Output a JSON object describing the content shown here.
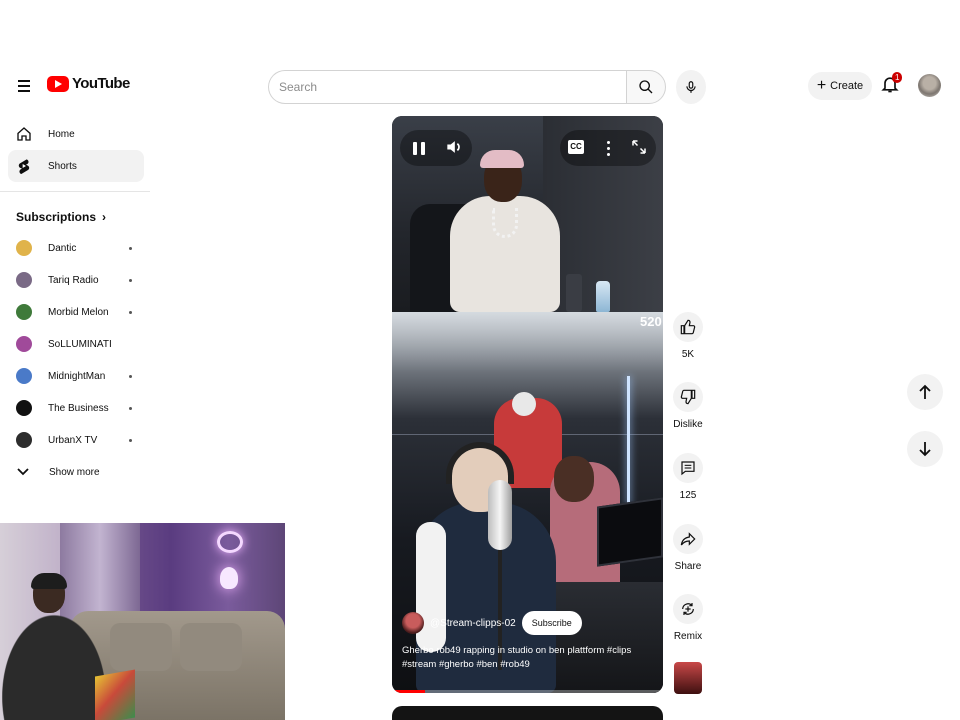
{
  "app": {
    "logo_text": "YouTube"
  },
  "header": {
    "search_placeholder": "Search",
    "create_label": "Create",
    "notifications_count": "1"
  },
  "sidebar": {
    "items": [
      {
        "label": "Home",
        "icon": "home-icon"
      },
      {
        "label": "Shorts",
        "icon": "shorts-icon",
        "active": true
      }
    ],
    "subscriptions_title": "Subscriptions",
    "subscriptions": [
      {
        "label": "Dantic",
        "color": "#e0b34a",
        "has_dot": true
      },
      {
        "label": "Tariq Radio",
        "color": "#7a6a86",
        "has_dot": true
      },
      {
        "label": "Morbid Melon",
        "color": "#3f7a3a",
        "has_dot": true
      },
      {
        "label": "SoLLUMINATI",
        "color": "#a04a9a",
        "has_dot": false
      },
      {
        "label": "MidnightMan",
        "color": "#4a7ac8",
        "has_dot": true
      },
      {
        "label": "The Business",
        "color": "#111111",
        "has_dot": true
      },
      {
        "label": "UrbanX TV",
        "color": "#2d2d2d",
        "has_dot": true
      }
    ],
    "show_more_label": "Show more"
  },
  "player": {
    "cc_label": "CC",
    "corner_number": "520",
    "channel_name": "@Stream-clipps-02",
    "subscribe_label": "Subscribe",
    "caption": "Gherbo rob49 rapping in studio on ben plattform #clips #stream #gherbo #ben #rob49",
    "progress": 0.12
  },
  "actions": {
    "like_count": "5K",
    "dislike_label": "Dislike",
    "comments_count": "125",
    "share_label": "Share",
    "remix_label": "Remix"
  }
}
